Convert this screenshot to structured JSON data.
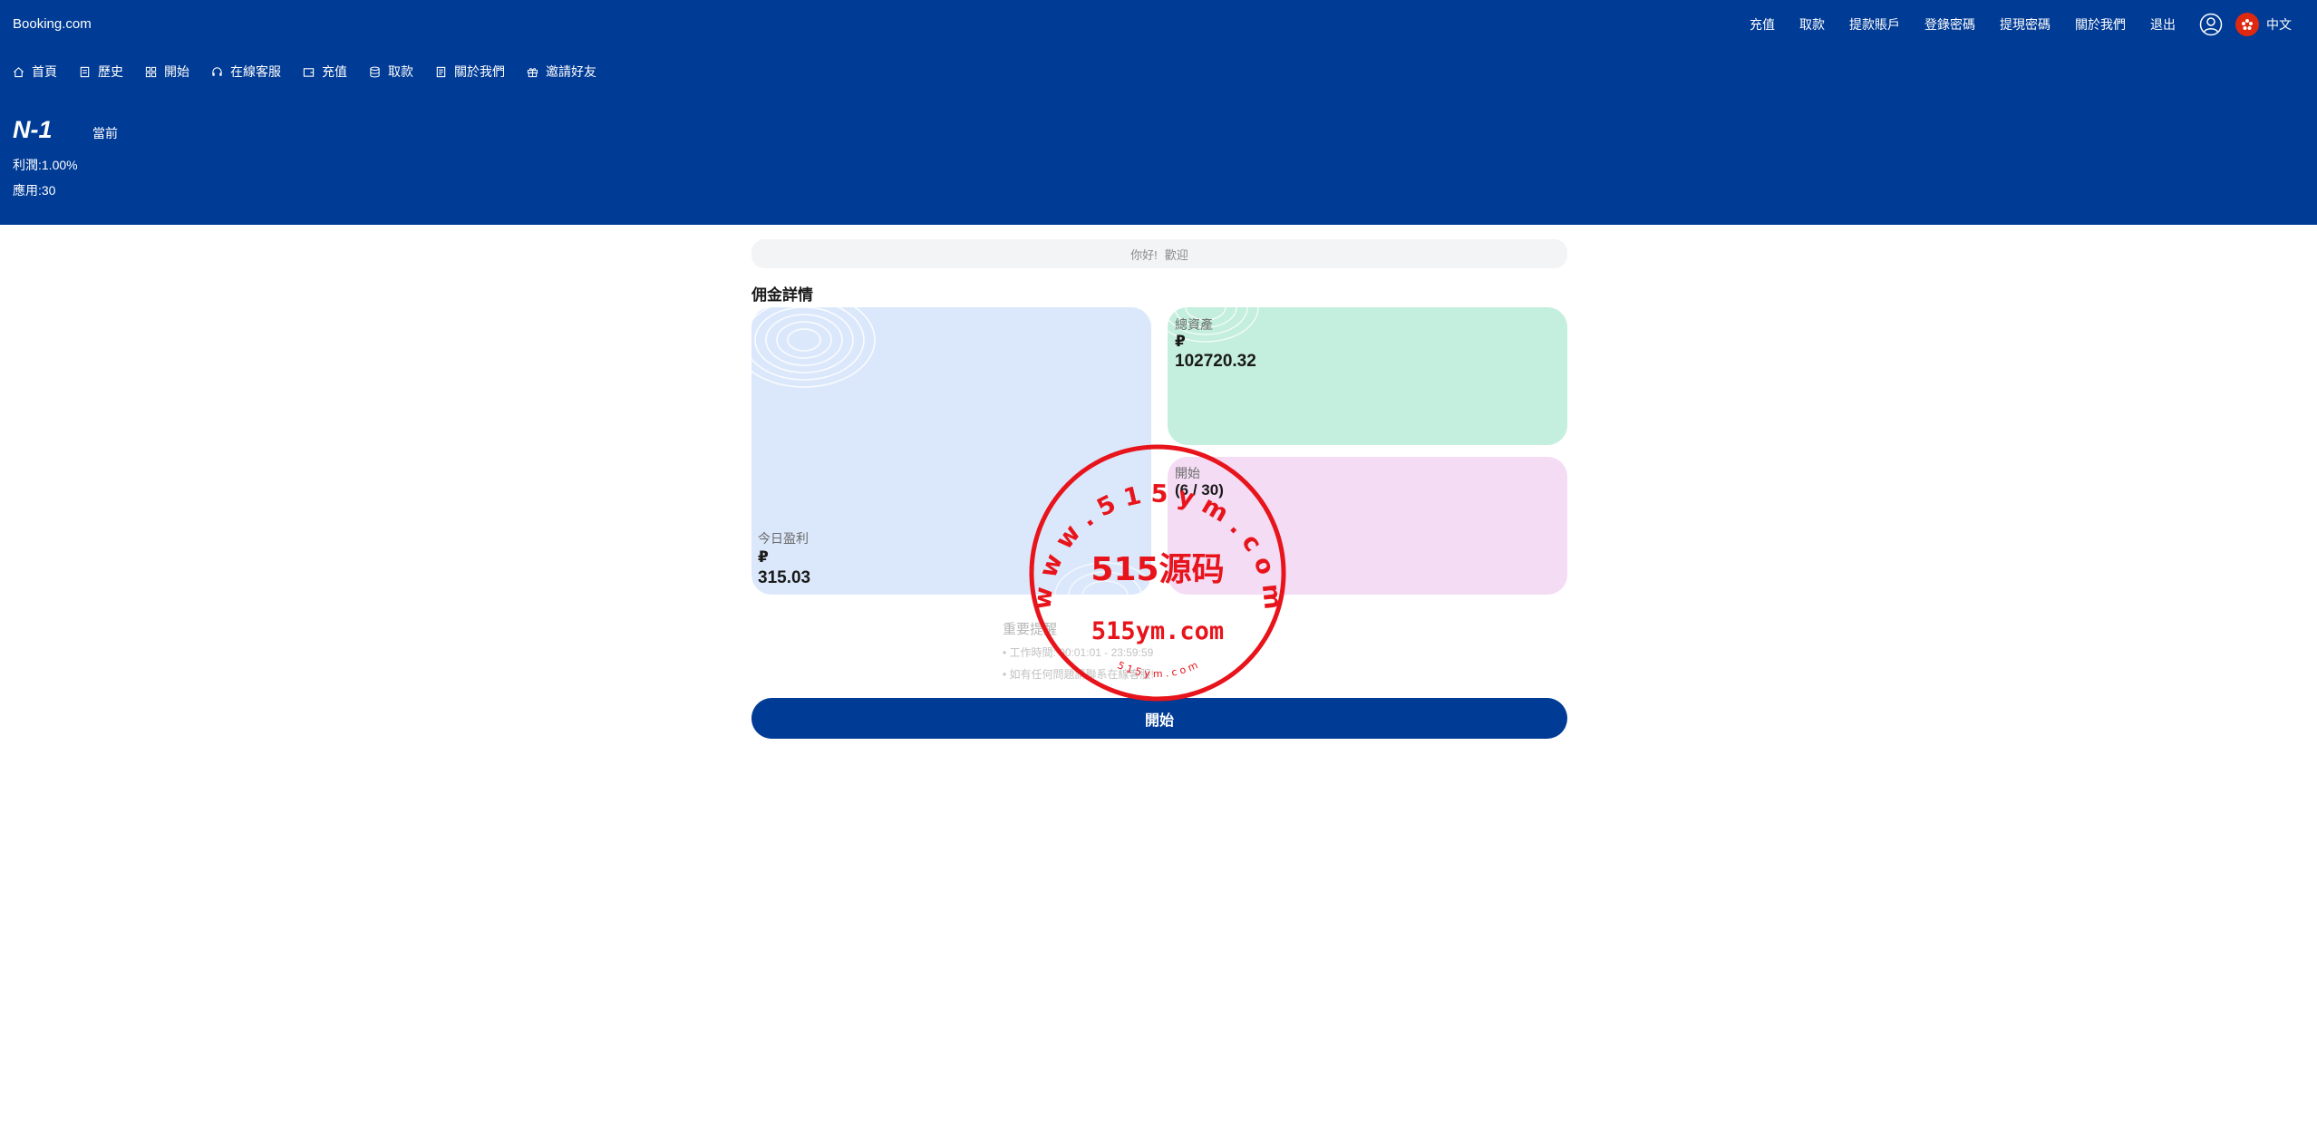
{
  "brand": "Booking.com",
  "top_nav": [
    "充值",
    "取款",
    "提款賬戶",
    "登錄密碼",
    "提現密碼",
    "關於我們",
    "退出"
  ],
  "language": "中文",
  "sub_nav": [
    {
      "label": "首頁",
      "icon": "home-icon"
    },
    {
      "label": "歷史",
      "icon": "document-icon"
    },
    {
      "label": "開始",
      "icon": "grid-icon"
    },
    {
      "label": "在線客服",
      "icon": "headset-icon"
    },
    {
      "label": "充值",
      "icon": "wallet-icon"
    },
    {
      "label": "取款",
      "icon": "coins-icon"
    },
    {
      "label": "關於我們",
      "icon": "info-document-icon"
    },
    {
      "label": "邀請好友",
      "icon": "gift-icon"
    }
  ],
  "level": {
    "name": "N-1",
    "status": "當前",
    "profit": "利潤:1.00%",
    "apply": "應用:30"
  },
  "greeting": {
    "hello": "你好!",
    "welcome": "歡迎"
  },
  "commission": {
    "title": "佣金詳情",
    "today_profit": {
      "label": "今日盈利",
      "currency": "₽",
      "value": "315.03"
    },
    "total_assets": {
      "label": "總資產",
      "currency": "₽",
      "value": "102720.32"
    },
    "start_progress": {
      "label": "開始",
      "value": "(6 / 30)"
    }
  },
  "notice": {
    "title": "重要提醒",
    "lines": [
      "• 工作時間: 00:01:01 - 23:59:59",
      "• 如有任何問題請聯系在線客服!"
    ]
  },
  "start_button": "開始",
  "watermark": {
    "center": "515源码",
    "domain": "515ym.com",
    "ring_text": "w w w . 5 1 5 y m . c o m",
    "small_text": "5 1 5 y m . c o m"
  },
  "colors": {
    "header_bg": "#003b95",
    "card_blue": "#dbe8fb",
    "card_green": "#c4eedd",
    "card_pink": "#f4dcf4",
    "stamp_red": "#e8141b"
  }
}
